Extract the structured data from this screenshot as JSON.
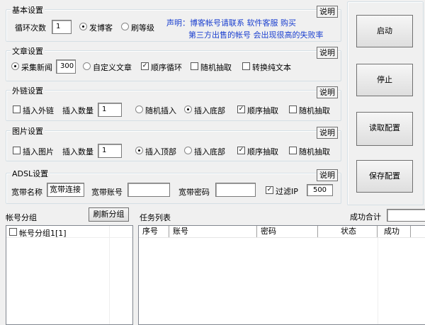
{
  "help_label": "说明",
  "basic": {
    "title": "基本设置",
    "loop_label": "循环次数",
    "loop_value": "1",
    "opt_post": "发博客",
    "opt_level": "刷等级",
    "notice_line1": "声明：博客帐号请联系 软件客服 购买",
    "notice_line2": "第三方出售的帐号 会出现很高的失败率"
  },
  "article": {
    "title": "文章设置",
    "opt_collect": "采集新闻",
    "collect_count": "300",
    "opt_custom": "自定义文章",
    "seq_loop": "顺序循环",
    "random_pick": "随机抽取",
    "plain_text": "转换纯文本"
  },
  "links": {
    "title": "外链设置",
    "insert": "插入外链",
    "count_label": "插入数量",
    "count": "1",
    "random_insert": "随机插入",
    "insert_bottom": "插入底部",
    "seq_pick": "顺序抽取",
    "random_pick": "随机抽取"
  },
  "images": {
    "title": "图片设置",
    "insert": "插入图片",
    "count_label": "插入数量",
    "count": "1",
    "insert_top": "插入顶部",
    "insert_bottom": "插入底部",
    "seq_pick": "顺序抽取",
    "random_pick": "随机抽取"
  },
  "adsl": {
    "title": "ADSL设置",
    "name_label": "宽带名称",
    "name_value": "宽带连接",
    "account_label": "宽带账号",
    "account_value": "",
    "password_label": "宽带密码",
    "password_value": "",
    "filter_ip": "过滤IP",
    "filter_value": "500"
  },
  "buttons": {
    "start": "启动",
    "stop": "停止",
    "load": "读取配置",
    "save": "保存配置"
  },
  "groups": {
    "title": "帐号分组",
    "refresh": "刷新分组",
    "items": [
      "帐号分组1[1]"
    ]
  },
  "tasks": {
    "title": "任务列表",
    "success_total_label": "成功合计",
    "success_total": "",
    "columns": [
      "序号",
      "账号",
      "密码",
      "状态",
      "成功"
    ]
  }
}
